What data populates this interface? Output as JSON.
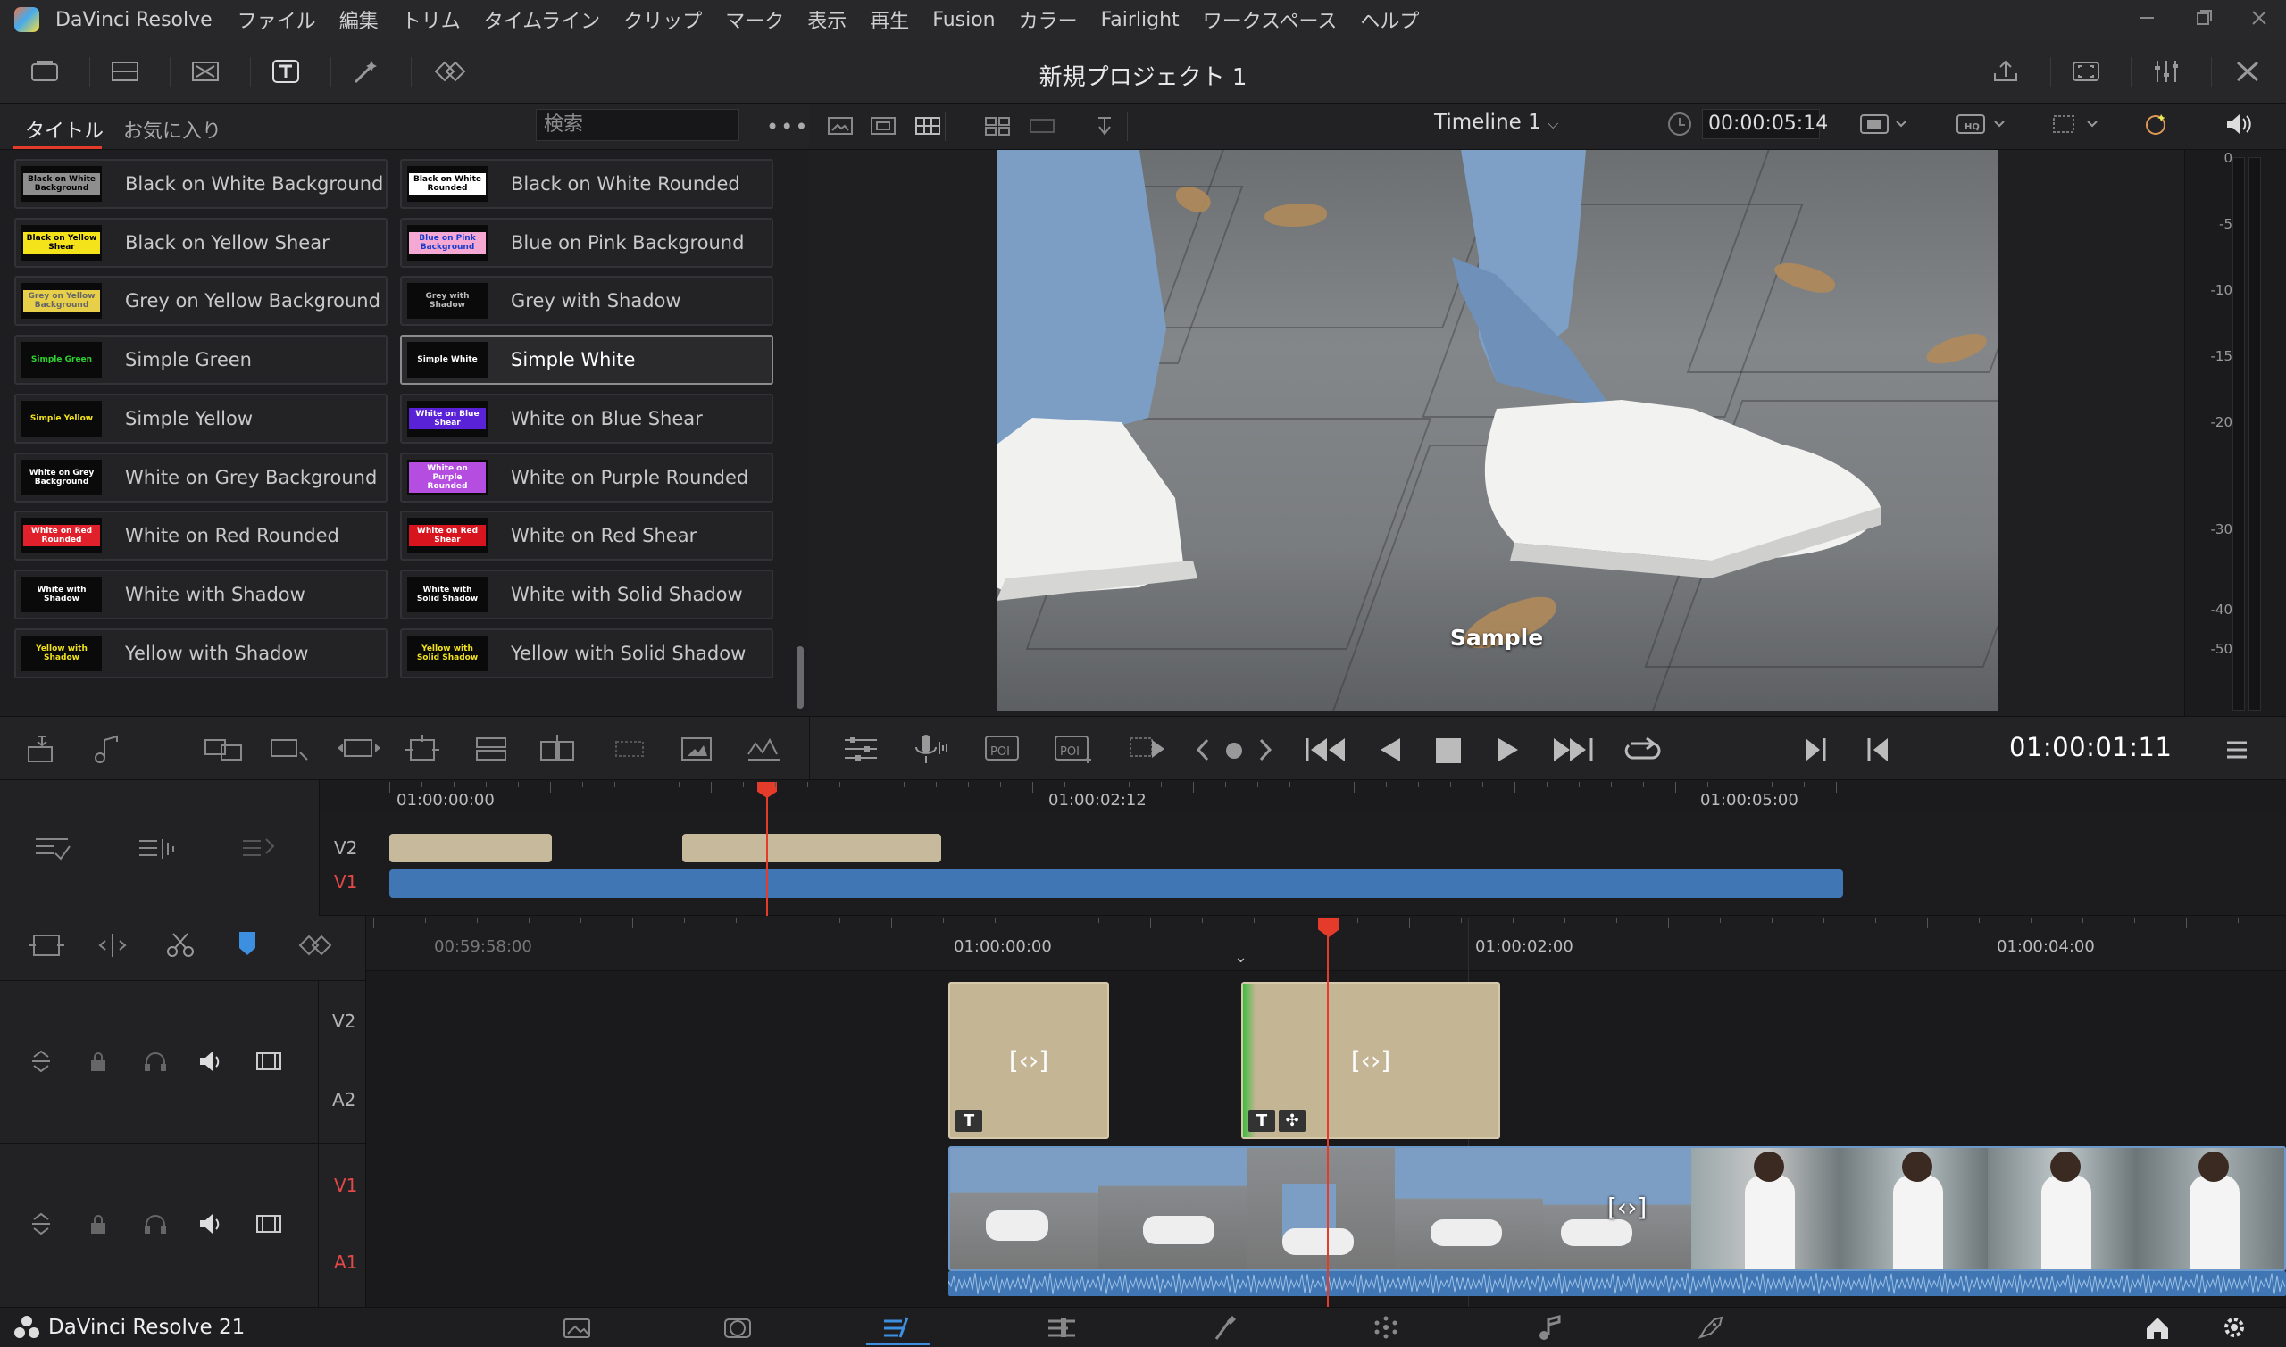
{
  "menubar": {
    "app_name": "DaVinci Resolve",
    "items": [
      "ファイル",
      "編集",
      "トリム",
      "タイムライン",
      "クリップ",
      "マーク",
      "表示",
      "再生",
      "Fusion",
      "カラー",
      "Fairlight",
      "ワークスペース",
      "ヘルプ"
    ]
  },
  "toolbar": {
    "project_title": "新規プロジェクト 1"
  },
  "browser": {
    "tabs": [
      "タイトル",
      "お気に入り"
    ],
    "search_placeholder": "検索",
    "titles": [
      {
        "label": "Black on White Background",
        "thumb": "Black on White Background",
        "bg": "#8e8e8e",
        "fg": "#000"
      },
      {
        "label": "Black on White Rounded",
        "thumb": "Black on White Rounded",
        "bg": "#ffffff",
        "fg": "#000"
      },
      {
        "label": "Black on Yellow Shear",
        "thumb": "Black on Yellow Shear",
        "bg": "#f4e21b",
        "fg": "#000"
      },
      {
        "label": "Blue on Pink Background",
        "thumb": "Blue on Pink Background",
        "bg": "#f5a8d4",
        "fg": "#1a3ccc"
      },
      {
        "label": "Grey on Yellow Background",
        "thumb": "Grey on Yellow Background",
        "bg": "#e8cf4a",
        "fg": "#666"
      },
      {
        "label": "Grey with Shadow",
        "thumb": "Grey with Shadow",
        "bg": "#0a0a0a",
        "fg": "#bbb"
      },
      {
        "label": "Simple Green",
        "thumb": "Simple Green",
        "bg": "#0a0a0a",
        "fg": "#2ed12e"
      },
      {
        "label": "Simple White",
        "thumb": "Simple White",
        "bg": "#0a0a0a",
        "fg": "#fff"
      },
      {
        "label": "Simple Yellow",
        "thumb": "Simple Yellow",
        "bg": "#0a0a0a",
        "fg": "#f2e21c"
      },
      {
        "label": "White on Blue Shear",
        "thumb": "White on Blue Shear",
        "bg": "#5a22d6",
        "fg": "#fff"
      },
      {
        "label": "White on Grey Background",
        "thumb": "White on Grey Background",
        "bg": "#0a0a0a",
        "fg": "#fff"
      },
      {
        "label": "White on Purple Rounded",
        "thumb": "White on Purple Rounded",
        "bg": "#b44de0",
        "fg": "#fff"
      },
      {
        "label": "White on Red Rounded",
        "thumb": "White on Red Rounded",
        "bg": "#e0202a",
        "fg": "#fff"
      },
      {
        "label": "White on Red Shear",
        "thumb": "White on Red Shear",
        "bg": "#d8141e",
        "fg": "#fff"
      },
      {
        "label": "White with Shadow",
        "thumb": "White with Shadow",
        "bg": "#0a0a0a",
        "fg": "#fff"
      },
      {
        "label": "White with Solid Shadow",
        "thumb": "White with Solid Shadow",
        "bg": "#0a0a0a",
        "fg": "#fff"
      },
      {
        "label": "Yellow with Shadow",
        "thumb": "Yellow with Shadow",
        "bg": "#0a0a0a",
        "fg": "#f2e21c"
      },
      {
        "label": "Yellow with Solid Shadow",
        "thumb": "Yellow with Solid Shadow",
        "bg": "#0a0a0a",
        "fg": "#f2e21c"
      }
    ],
    "selected": "Simple White"
  },
  "viewer": {
    "timeline_name": "Timeline 1",
    "source_timecode": "00:00:05:14",
    "overlay_text": "Sample",
    "record_timecode": "01:00:01:11",
    "meter_ticks": [
      "0",
      "-5",
      "-10",
      "-15",
      "-20",
      "-30",
      "-40",
      "-50"
    ]
  },
  "upper_timeline": {
    "ruler": [
      "01:00:00:00",
      "01:00:02:12",
      "01:00:05:00"
    ],
    "tracks": [
      {
        "label": "V2",
        "color": "#b4b4b4"
      },
      {
        "label": "V1",
        "color": "#e24848"
      }
    ]
  },
  "lower_timeline": {
    "ruler": [
      "00:59:58:00",
      "01:00:00:00",
      "01:00:02:00",
      "01:00:04:00"
    ],
    "tracks": [
      {
        "label": "V2",
        "color": "#b4b4b4"
      },
      {
        "label": "A2",
        "color": "#b4b4b4"
      },
      {
        "label": "V1",
        "color": "#e24848"
      },
      {
        "label": "A1",
        "color": "#e24848"
      }
    ],
    "clip_icon": "[‹›]"
  },
  "bottom": {
    "brand": "DaVinci Resolve 21"
  },
  "colors": {
    "accent": "#e43b2b",
    "selected_page": "#3d8fe0",
    "title_clip": "#c4b595",
    "video_clip": "#3f76b3"
  }
}
